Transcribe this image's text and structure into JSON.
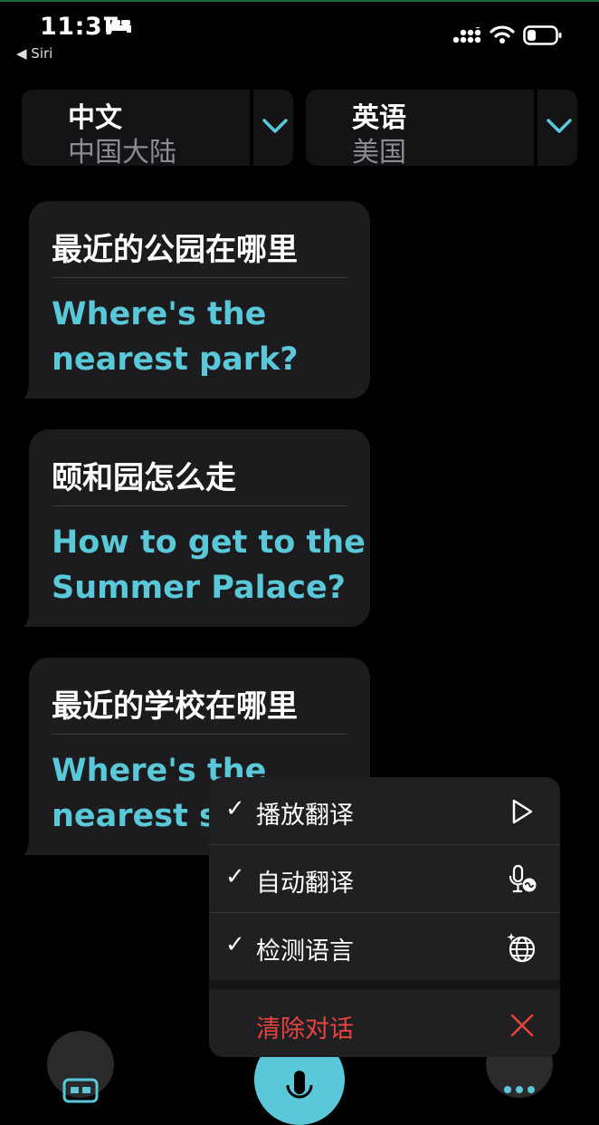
{
  "status_bar": {
    "time": "11:37",
    "back_label": "◀ Siri"
  },
  "languages": {
    "source": {
      "language": "中文",
      "region": "中国大陆"
    },
    "target": {
      "language": "英语",
      "region": "美国"
    }
  },
  "conversation": [
    {
      "original": "最近的公园在哪里",
      "translation": "Where's the nearest park?"
    },
    {
      "original": "颐和园怎么走",
      "translation": "How to get to the Summer Palace?"
    },
    {
      "original": "最近的学校在哪里",
      "translation": "Where's the nearest s"
    }
  ],
  "menu": {
    "items": [
      {
        "label": "播放翻译",
        "checked": true,
        "icon": "play-icon"
      },
      {
        "label": "自动翻译",
        "checked": true,
        "icon": "mic-auto-icon"
      },
      {
        "label": "检测语言",
        "checked": true,
        "icon": "globe-detect-icon"
      }
    ],
    "clear_label": "清除对话",
    "check_glyph": "✓"
  },
  "colors": {
    "accent": "#5ac8d8",
    "destructive": "#e8433e",
    "bubble": "#1c1c1e"
  }
}
